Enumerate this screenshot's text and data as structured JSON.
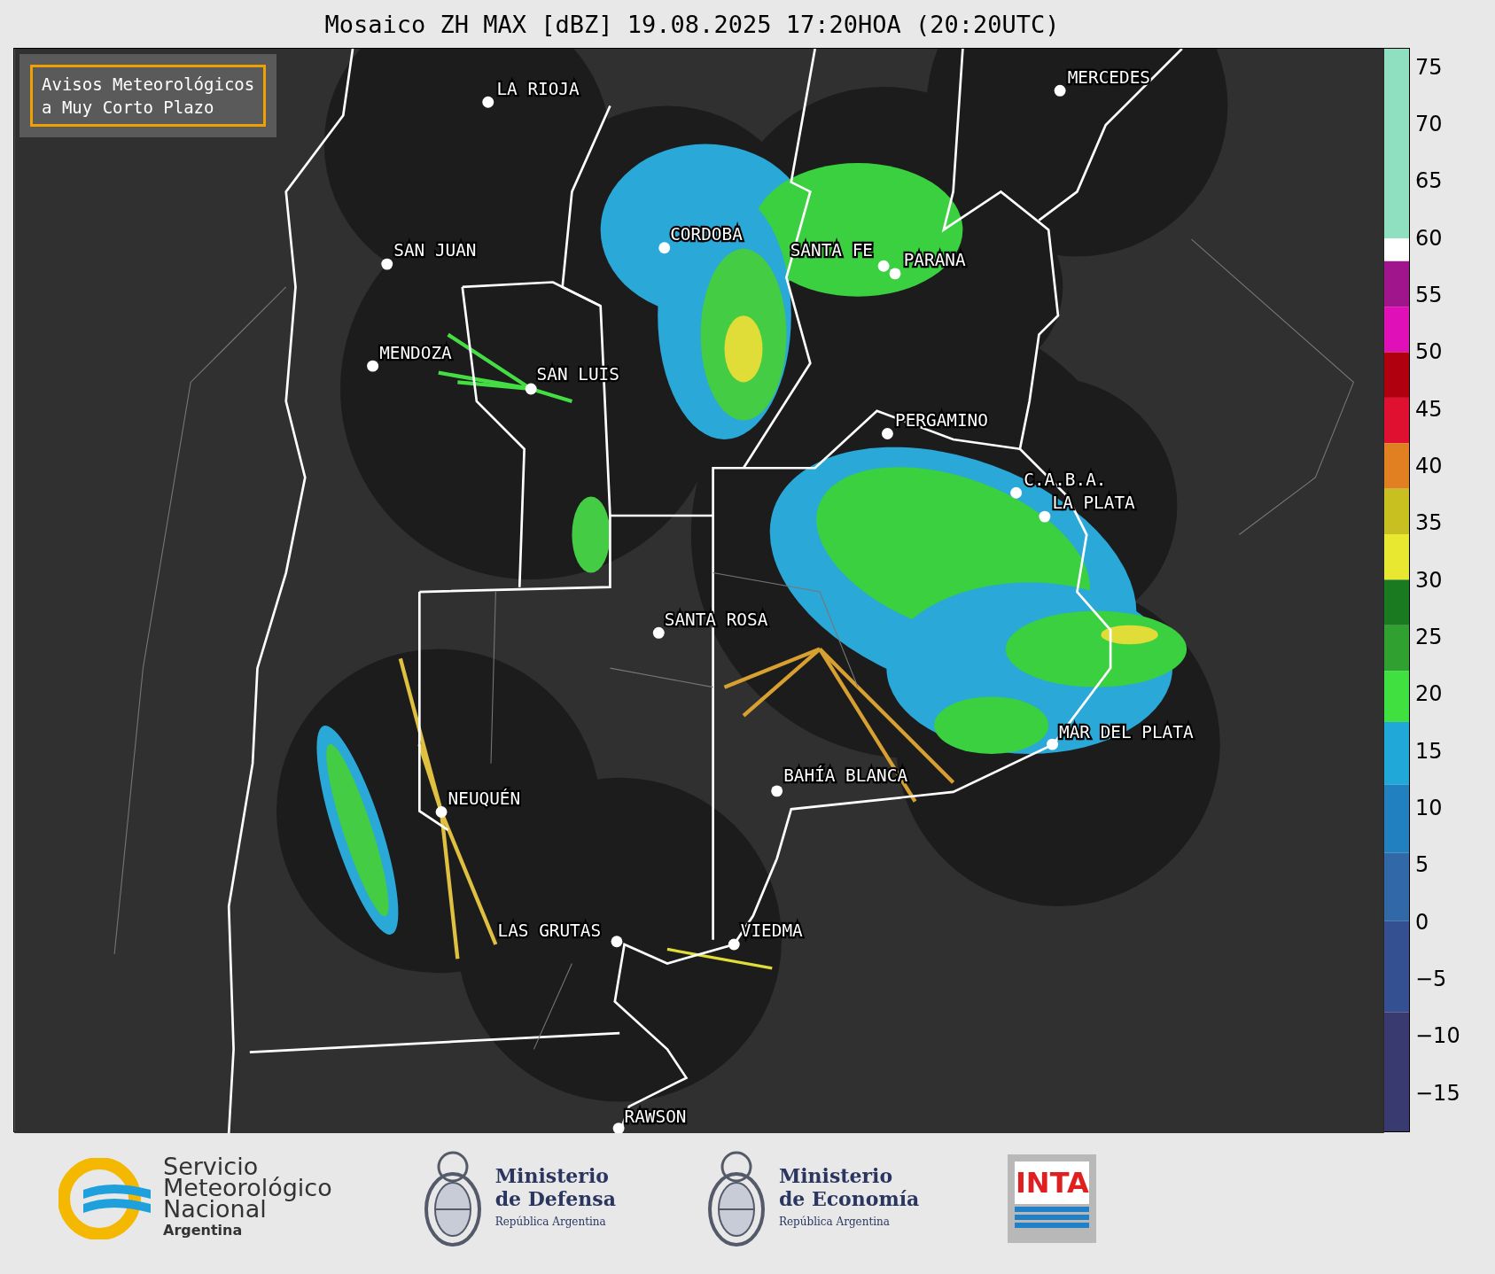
{
  "title": "Mosaico ZH MAX [dBZ] 19.08.2025 17:20HOA (20:20UTC)",
  "notice": {
    "lines": [
      "Avisos Meteorológicos",
      "a Muy Corto Plazo"
    ]
  },
  "map": {
    "cities": [
      {
        "name": "LA RIOJA"
      },
      {
        "name": "MERCEDES"
      },
      {
        "name": "SAN JUAN"
      },
      {
        "name": "CORDOBA"
      },
      {
        "name": "SANTA FE"
      },
      {
        "name": "PARANA"
      },
      {
        "name": "MENDOZA"
      },
      {
        "name": "SAN LUIS"
      },
      {
        "name": "PERGAMINO"
      },
      {
        "name": "C.A.B.A."
      },
      {
        "name": "LA PLATA"
      },
      {
        "name": "SANTA ROSA"
      },
      {
        "name": "MAR DEL PLATA"
      },
      {
        "name": "BAHÍA BLANCA"
      },
      {
        "name": "NEUQUÉN"
      },
      {
        "name": "LAS GRUTAS"
      },
      {
        "name": "VIEDMA"
      },
      {
        "name": "RAWSON"
      }
    ]
  },
  "colorbar": {
    "ticks": [
      "75",
      "70",
      "65",
      "60",
      "55",
      "50",
      "45",
      "40",
      "35",
      "30",
      "25",
      "20",
      "15",
      "10",
      "5",
      "0",
      "−5",
      "−10",
      "−15"
    ]
  },
  "logos": [
    {
      "kind": "smn",
      "lines": [
        "Servicio",
        "Meteorológico",
        "Nacional"
      ],
      "subtitle": "Argentina"
    },
    {
      "kind": "ministry",
      "lines": [
        "Ministerio",
        "de Defensa"
      ],
      "subtitle": "República Argentina"
    },
    {
      "kind": "ministry",
      "lines": [
        "Ministerio",
        "de Economía"
      ],
      "subtitle": "República Argentina"
    },
    {
      "kind": "inta",
      "text": "INTA"
    }
  ]
}
